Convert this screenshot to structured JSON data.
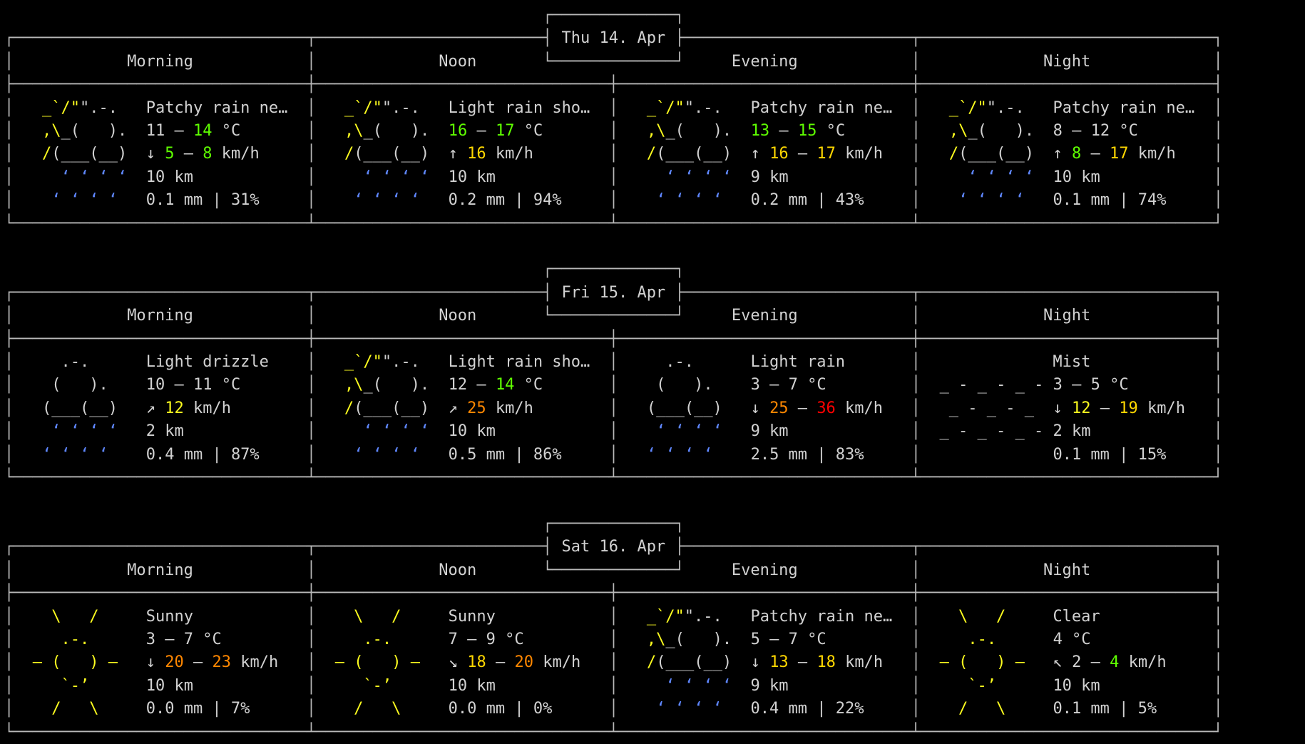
{
  "app": {
    "title": "wttr.in terminal weather forecast",
    "columns": [
      "Morning",
      "Noon",
      "Evening",
      "Night"
    ],
    "frame_color": "#b9b9b9",
    "background": "#000000",
    "palette": {
      "text": "#d2d2d2",
      "art_yellow": "#fdfd1f",
      "rain_blue": "#5f87ff",
      "temp_green": "#5fff00",
      "wind_gold": "#ffd700",
      "wind_orange": "#ff8700",
      "wind_red": "#ff0000"
    }
  },
  "days": [
    {
      "date_label": "Thu 14. Apr",
      "periods": [
        {
          "slot": "Morning",
          "art": "cloud-rain-light",
          "condition": "Patchy rain ne…",
          "temp": "11 – 14 °C",
          "temp_low": "11",
          "temp_high": "14",
          "temp_high_color": "#5fff00",
          "wind_arrow": "↓",
          "wind": "5 – 8 km/h",
          "wind_low": "5",
          "wind_high": "8",
          "wind_low_color": "#5fff00",
          "wind_high_color": "#5fff00",
          "visibility": "10 km",
          "precipitation": "0.1 mm | 31%"
        },
        {
          "slot": "Noon",
          "art": "cloud-rain-light",
          "condition": "Light rain sho…",
          "temp": "16 – 17 °C",
          "temp_low": "16",
          "temp_high": "17",
          "temp_low_color": "#5fff00",
          "temp_high_color": "#5fff00",
          "wind_arrow": "↑",
          "wind": "16 km/h",
          "wind_low": "16",
          "wind_low_color": "#ffd700",
          "visibility": "10 km",
          "precipitation": "0.2 mm | 94%"
        },
        {
          "slot": "Evening",
          "art": "cloud-rain-light",
          "condition": "Patchy rain ne…",
          "temp": "13 – 15 °C",
          "temp_low": "13",
          "temp_high": "15",
          "temp_low_color": "#5fff00",
          "temp_high_color": "#5fff00",
          "wind_arrow": "↑",
          "wind": "16 – 17 km/h",
          "wind_low": "16",
          "wind_high": "17",
          "wind_low_color": "#ffd700",
          "wind_high_color": "#ffd700",
          "visibility": "9 km",
          "precipitation": "0.2 mm | 43%"
        },
        {
          "slot": "Night",
          "art": "cloud-rain-light",
          "condition": "Patchy rain ne…",
          "temp": "8 – 12 °C",
          "temp_low": "8",
          "temp_high": "12",
          "wind_arrow": "↑",
          "wind": "8 – 17 km/h",
          "wind_low": "8",
          "wind_high": "17",
          "wind_low_color": "#5fff00",
          "wind_high_color": "#ffd700",
          "visibility": "10 km",
          "precipitation": "0.1 mm | 74%"
        }
      ]
    },
    {
      "date_label": "Fri 15. Apr",
      "periods": [
        {
          "slot": "Morning",
          "art": "cloud-drizzle",
          "condition": "Light drizzle",
          "temp": "10 – 11 °C",
          "temp_low": "10",
          "temp_high": "11",
          "wind_arrow": "↗",
          "wind": "12 km/h",
          "wind_low": "12",
          "wind_low_color": "#fdfd1f",
          "visibility": "2 km",
          "precipitation": "0.4 mm | 87%"
        },
        {
          "slot": "Noon",
          "art": "cloud-rain-light",
          "condition": "Light rain sho…",
          "temp": "12 – 14 °C",
          "temp_low": "12",
          "temp_high": "14",
          "temp_high_color": "#5fff00",
          "wind_arrow": "↗",
          "wind": "25 km/h",
          "wind_low": "25",
          "wind_low_color": "#ff8700",
          "visibility": "10 km",
          "precipitation": "0.5 mm | 86%"
        },
        {
          "slot": "Evening",
          "art": "cloud-drizzle",
          "condition": "Light rain",
          "temp": "3 – 7 °C",
          "temp_low": "3",
          "temp_high": "7",
          "wind_arrow": "↓",
          "wind": "25 – 36 km/h",
          "wind_low": "25",
          "wind_high": "36",
          "wind_low_color": "#ff8700",
          "wind_high_color": "#ff0000",
          "visibility": "9 km",
          "precipitation": "2.5 mm | 83%"
        },
        {
          "slot": "Night",
          "art": "mist",
          "condition": "Mist",
          "temp": "3 – 5 °C",
          "temp_low": "3",
          "temp_high": "5",
          "wind_arrow": "↓",
          "wind": "12 – 19 km/h",
          "wind_low": "12",
          "wind_high": "19",
          "wind_low_color": "#fdfd1f",
          "wind_high_color": "#ffd700",
          "visibility": "2 km",
          "precipitation": "0.1 mm | 15%"
        }
      ]
    },
    {
      "date_label": "Sat 16. Apr",
      "periods": [
        {
          "slot": "Morning",
          "art": "sun",
          "condition": "Sunny",
          "temp": "3 – 7 °C",
          "temp_low": "3",
          "temp_high": "7",
          "wind_arrow": "↓",
          "wind": "20 – 23 km/h",
          "wind_low": "20",
          "wind_high": "23",
          "wind_low_color": "#ff8700",
          "wind_high_color": "#ff8700",
          "visibility": "10 km",
          "precipitation": "0.0 mm | 7%"
        },
        {
          "slot": "Noon",
          "art": "sun",
          "condition": "Sunny",
          "temp": "7 – 9 °C",
          "temp_low": "7",
          "temp_high": "9",
          "wind_arrow": "↘",
          "wind": "18 – 20 km/h",
          "wind_low": "18",
          "wind_high": "20",
          "wind_low_color": "#ffd700",
          "wind_high_color": "#ff8700",
          "visibility": "10 km",
          "precipitation": "0.0 mm | 0%"
        },
        {
          "slot": "Evening",
          "art": "cloud-rain-light",
          "condition": "Patchy rain ne…",
          "temp": "5 – 7 °C",
          "temp_low": "5",
          "temp_high": "7",
          "wind_arrow": "↓",
          "wind": "13 – 18 km/h",
          "wind_low": "13",
          "wind_high": "18",
          "wind_low_color": "#ffd700",
          "wind_high_color": "#ffd700",
          "visibility": "9 km",
          "precipitation": "0.4 mm | 22%"
        },
        {
          "slot": "Night",
          "art": "sun",
          "condition": "Clear",
          "temp": "4 °C",
          "temp_low": "4",
          "wind_arrow": "↖",
          "wind": "2 – 4 km/h",
          "wind_low": "2",
          "wind_high": "4",
          "wind_high_color": "#5fff00",
          "visibility": "10 km",
          "precipitation": "0.1 mm | 5%"
        }
      ]
    }
  ],
  "art": {
    "cloud-rain-light": [
      "  _`/\"\".-.  ",
      "  ,\\_(   ). ",
      "  /(___(__) ",
      "    ‘ ‘ ‘ ‘ ",
      "   ‘ ‘ ‘ ‘  "
    ],
    "cloud-drizzle": [
      "    .-.     ",
      "   (   ).   ",
      "  (___(__)  ",
      "   ‘ ‘ ‘ ‘  ",
      "  ‘ ‘ ‘ ‘   "
    ],
    "mist": [
      "            ",
      " _ - _ - _ -",
      "  _ - _ - _ ",
      " _ - _ - _ -",
      "            "
    ],
    "sun": [
      "   \\   /    ",
      "    .-.     ",
      " ― (   ) ―  ",
      "    `-’     ",
      "   /   \\    "
    ]
  }
}
